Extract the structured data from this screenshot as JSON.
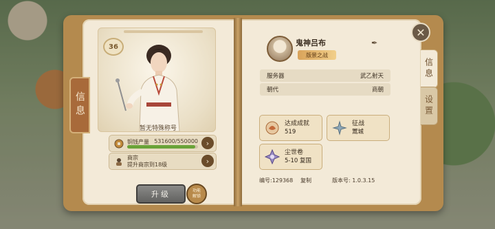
{
  "left_tab": {
    "label": "信息"
  },
  "right_tabs": [
    {
      "label": "信息",
      "active": true
    },
    {
      "label": "设置",
      "active": false
    }
  ],
  "character": {
    "level": "36",
    "title": "暂无特殊称号",
    "stats": [
      {
        "icon": "coin-icon",
        "label": "铜钱产量",
        "value": "531600/550000",
        "progress": 0.9665
      },
      {
        "icon": "merchant-icon",
        "label": "商宗",
        "value": "提升商宗到18级"
      }
    ],
    "upgrade_label": "升级",
    "unlock_label": "功能\n解锁"
  },
  "profile": {
    "name": "鬼神吕布",
    "title_tag": "版景之战",
    "rows": [
      {
        "key": "服务器",
        "value": "武乙射天"
      },
      {
        "key": "朝代",
        "value": "商朝"
      }
    ],
    "achievements": [
      {
        "icon": "achievement-icon",
        "label": "达成成就",
        "value": "519"
      },
      {
        "icon": "conquest-icon",
        "label": "征战",
        "value": "鬻城"
      },
      {
        "icon": "dust-world-icon",
        "label": "尘世卷",
        "value": "5-10 复国"
      }
    ],
    "id_label": "编号:129368",
    "copy_label": "复制",
    "version_label": "版本号: 1.0.3.15"
  },
  "colors": {
    "accent": "#6b4c2a",
    "progress_green": "#6aa338",
    "page": "#f3ead8"
  }
}
